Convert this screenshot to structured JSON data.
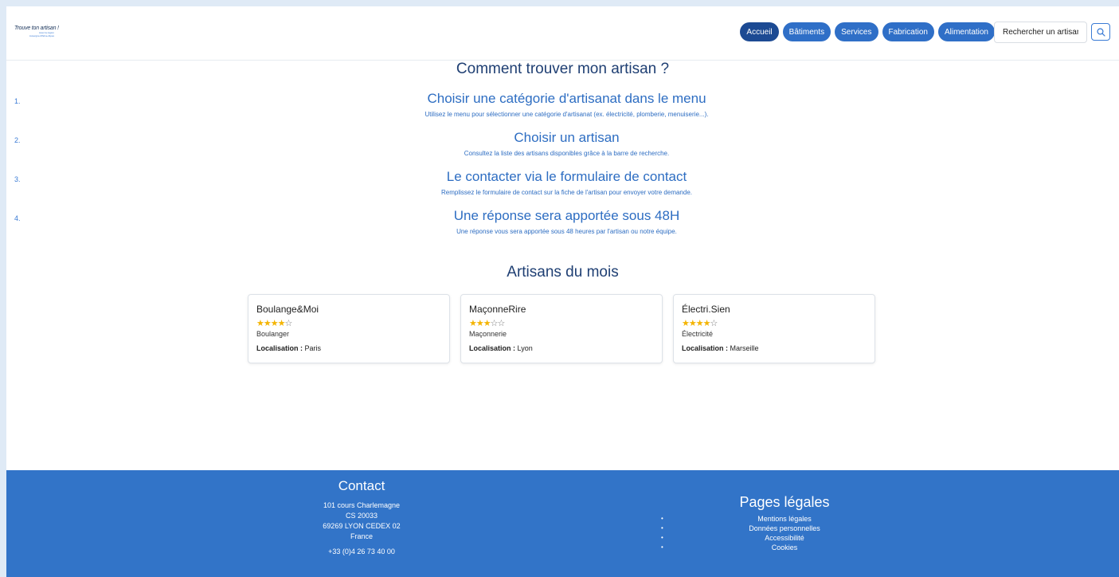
{
  "header": {
    "logo": {
      "line1": "Trouve ton artisan !",
      "line2": "Avec la région",
      "line3": "Auvergne-Rhône-Alpes"
    },
    "nav": [
      "Accueil",
      "Bâtiments",
      "Services",
      "Fabrication",
      "Alimentation"
    ],
    "search_placeholder": "Rechercher un artisan"
  },
  "howto": {
    "title": "Comment trouver mon artisan ?",
    "steps": [
      {
        "num": "1.",
        "title": "Choisir une catégorie d'artisanat dans le menu",
        "desc": "Utilisez le menu pour sélectionner une catégorie d'artisanat (ex. électricité, plomberie, menuiserie...)."
      },
      {
        "num": "2.",
        "title": "Choisir un artisan",
        "desc": "Consultez la liste des artisans disponibles grâce à la barre de recherche."
      },
      {
        "num": "3.",
        "title": "Le contacter via le formulaire de contact",
        "desc": "Remplissez le formulaire de contact sur la fiche de l'artisan pour envoyer votre demande."
      },
      {
        "num": "4.",
        "title": "Une réponse sera apportée sous 48H",
        "desc": "Une réponse vous sera apportée sous 48 heures par l'artisan ou notre équipe."
      }
    ]
  },
  "artisans": {
    "title": "Artisans du mois",
    "location_label": "Localisation :",
    "cards": [
      {
        "name": "Boulange&Moi",
        "rating": 4,
        "max_rating": 5,
        "category": "Boulanger",
        "location": "Paris"
      },
      {
        "name": "MaçonneRire",
        "rating": 3,
        "max_rating": 5,
        "category": "Maçonnerie",
        "location": "Lyon"
      },
      {
        "name": "Électri.Sien",
        "rating": 4,
        "max_rating": 5,
        "category": "Électricité",
        "location": "Marseille"
      }
    ]
  },
  "footer": {
    "contact": {
      "title": "Contact",
      "address": [
        "101 cours Charlemagne",
        "CS 20033",
        "69269 LYON CEDEX 02",
        "France"
      ],
      "phone": "+33 (0)4 26 73 40 00"
    },
    "legal": {
      "title": "Pages légales",
      "links": [
        "Mentions légales",
        "Données personnelles",
        "Accessibilité",
        "Cookies"
      ]
    }
  },
  "colors": {
    "primary": "#3274c8",
    "active_nav": "#1c4a93",
    "title": "#1f3f73",
    "star": "#f4b400"
  }
}
